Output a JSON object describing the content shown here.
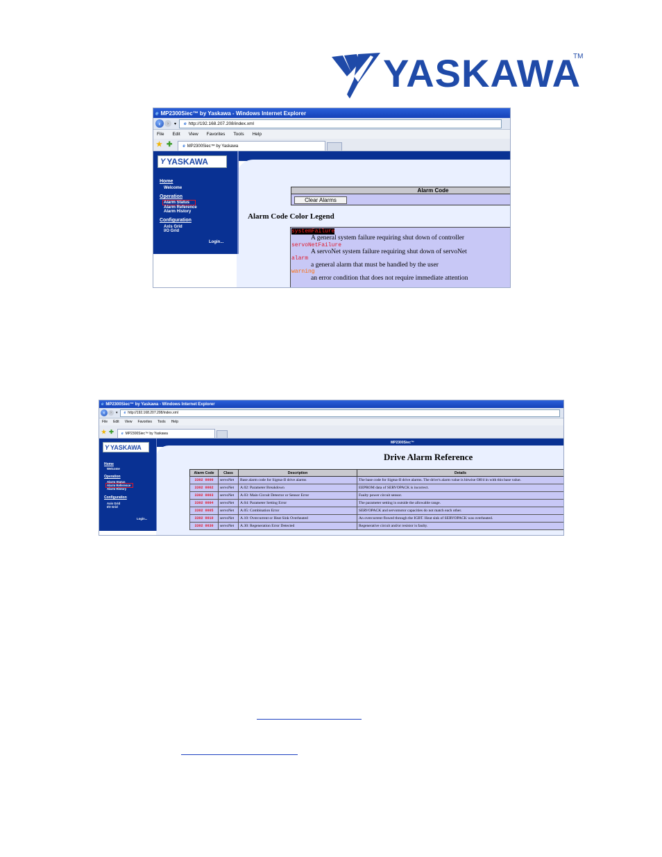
{
  "brand": {
    "name": "YASKAWA",
    "tm": "TM"
  },
  "screenshot1": {
    "window_title": "MP2300Siec™ by Yaskawa - Windows Internet Explorer",
    "address": "http://192.168.207.208/index.xml",
    "menu": [
      "File",
      "Edit",
      "View",
      "Favorites",
      "Tools",
      "Help"
    ],
    "tab_label": "MP2300Siec™ by Yaskawa",
    "logo": "YASKAWA",
    "nav": {
      "home": "Home",
      "welcome": "Welcome",
      "operation": "Operation",
      "alarm_status": "Alarm Status",
      "alarm_reference": "Alarm Reference",
      "alarm_history": "Alarm History",
      "configuration": "Configuration",
      "axis_grid": "Axis Grid",
      "io_grid": "I/O Grid",
      "login": "Login..."
    },
    "alarm_code_header": "Alarm Code",
    "clear_button": "Clear Alarms",
    "legend_title": "Alarm Code Color Legend",
    "legend": [
      {
        "name": "systemFailure",
        "desc": "A general system failure requiring shut down of controller",
        "color": "#ff2020",
        "bg": "#000000"
      },
      {
        "name": "servoNetFailure",
        "desc": "A servoNet system failure requiring shut down of servoNet",
        "color": "#e0192a",
        "bg": ""
      },
      {
        "name": "alarm",
        "desc": "a general alarm that must be handled by the user",
        "color": "#e0192a",
        "bg": ""
      },
      {
        "name": "warning",
        "desc": "an error condition that does not require immediate attention",
        "color": "#ff6a00",
        "bg": ""
      }
    ]
  },
  "screenshot2": {
    "window_title": "MP2300Siec™ by Yaskawa - Windows Internet Explorer",
    "address": "http://192.168.207.208/index.xml",
    "menu": [
      "File",
      "Edit",
      "View",
      "Favorites",
      "Tools",
      "Help"
    ],
    "tab_label": "MP2300Siec™ by Yaskawa",
    "logo": "YASKAWA",
    "app_title": "MP2300Siec™",
    "heading": "Drive Alarm Reference",
    "nav": {
      "home": "Home",
      "welcome": "Welcome",
      "operation": "Operation",
      "alarm_status": "Alarm Status",
      "alarm_reference": "Alarm Reference",
      "alarm_history": "Alarm History",
      "configuration": "Configuration",
      "axis_grid": "Axis Grid",
      "io_grid": "I/O Grid",
      "login": "Login..."
    },
    "columns": [
      "Alarm Code",
      "Class",
      "Description",
      "Details"
    ],
    "rows": [
      {
        "code": "3302 0000",
        "class": "servoNet",
        "description": "Base alarm code for Sigma-II drive alarms",
        "details": "The base code for Sigma-II drive alarms. The drive's alarm value is bitwise OR'd in with this base value."
      },
      {
        "code": "3302 0002",
        "class": "servoNet",
        "description": "A.02: Parameter Breakdown",
        "details": "EEPROM data of SERVOPACK is incorrect."
      },
      {
        "code": "3302 0003",
        "class": "servoNet",
        "description": "A.03: Main Circuit Detector or Sensor Error",
        "details": "Faulty power circuit sensor."
      },
      {
        "code": "3302 0004",
        "class": "servoNet",
        "description": "A.04: Parameter Setting Error",
        "details": "The parameter setting is outside the allowable range."
      },
      {
        "code": "3302 0005",
        "class": "servoNet",
        "description": "A.05: Combination Error",
        "details": "SERVOPACK and servomotor capacities do not match each other."
      },
      {
        "code": "3302 0010",
        "class": "servoNet",
        "description": "A.10: Overcurrent or Heat Sink Overheated",
        "details": "An overcurrent flowed through the IGBT. Heat sink of SERVOPACK was overheated."
      },
      {
        "code": "3302 0030",
        "class": "servoNet",
        "description": "A.30: Regeneration Error Detected",
        "details": "Regenerative circuit and/or resistor is faulty."
      }
    ]
  }
}
